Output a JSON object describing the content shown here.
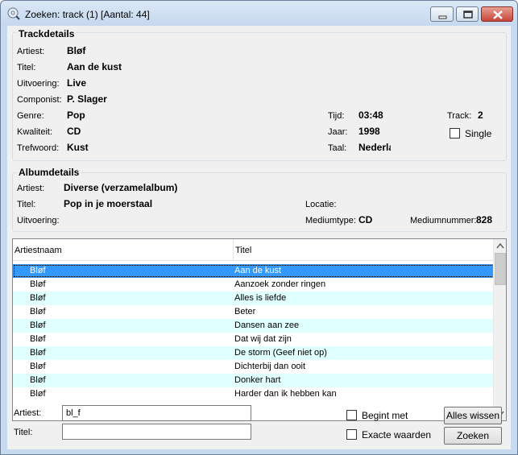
{
  "window": {
    "title": "Zoeken: track (1) [Aantal: 44]"
  },
  "track": {
    "section_title": "Trackdetails",
    "artist_label": "Artiest:",
    "artist": "Bløf",
    "title_label": "Titel:",
    "title": "Aan de kust",
    "performance_label": "Uitvoering:",
    "performance": "Live",
    "composer_label": "Componist:",
    "composer": "P. Slager",
    "genre_label": "Genre:",
    "genre": "Pop",
    "quality_label": "Kwaliteit:",
    "quality": "CD",
    "keyword_label": "Trefwoord:",
    "keyword": "Kust",
    "time_label": "Tijd:",
    "time": "03:48",
    "year_label": "Jaar:",
    "year": "1998",
    "language_label": "Taal:",
    "language": "Nederlands",
    "track_label": "Track:",
    "track_no": "2",
    "single_label": "Single"
  },
  "album": {
    "section_title": "Albumdetails",
    "artist_label": "Artiest:",
    "artist": "Diverse (verzamelalbum)",
    "title_label": "Titel:",
    "title": "Pop in je moerstaal",
    "performance_label": "Uitvoering:",
    "location_label": "Locatie:",
    "mediumtype_label": "Mediumtype:",
    "mediumtype": "CD",
    "mediumnumber_label": "Mediumnummer:",
    "mediumnumber": "828"
  },
  "list": {
    "columns": [
      "Artiestnaam",
      "Titel"
    ],
    "rows": [
      {
        "artist": "Bløf",
        "title": "Aan de kust"
      },
      {
        "artist": "Bløf",
        "title": "Aanzoek zonder ringen"
      },
      {
        "artist": "Bløf",
        "title": "Alles is liefde"
      },
      {
        "artist": "Bløf",
        "title": "Beter"
      },
      {
        "artist": "Bløf",
        "title": "Dansen aan zee"
      },
      {
        "artist": "Bløf",
        "title": "Dat wij dat zijn"
      },
      {
        "artist": "Bløf",
        "title": "De storm (Geef niet op)"
      },
      {
        "artist": "Bløf",
        "title": "Dichterbij dan ooit"
      },
      {
        "artist": "Bløf",
        "title": "Donker hart"
      },
      {
        "artist": "Bløf",
        "title": "Harder dan ik hebben kan"
      }
    ]
  },
  "search": {
    "artist_label": "Artiest:",
    "artist_value": "bl_f",
    "title_label": "Titel:",
    "title_value": "",
    "begins_with_label": "Begint met",
    "exact_label": "Exacte waarden",
    "clear_button": "Alles wissen",
    "search_button": "Zoeken"
  },
  "colors": {
    "selection": "#3399ff",
    "alt_row": "#e0ffff",
    "title_bar": "#c5d8ee"
  }
}
